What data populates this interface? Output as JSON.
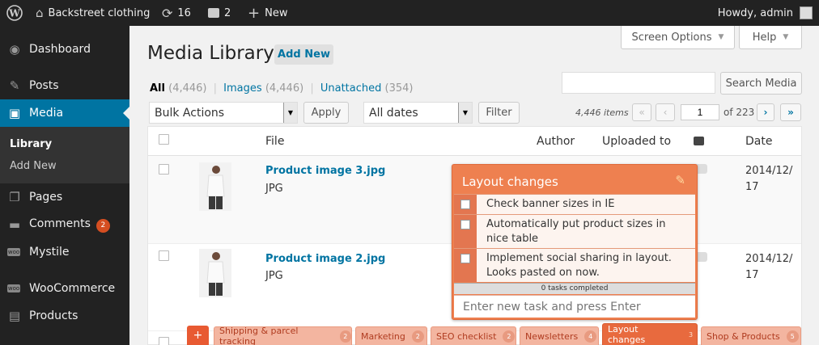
{
  "adminbar": {
    "site_name": "Backstreet clothing",
    "updates_count": "16",
    "comments_count": "2",
    "new_label": "New",
    "howdy": "Howdy, admin"
  },
  "sidebar": {
    "items": [
      {
        "label": "Dashboard",
        "icon": "dashboard-icon"
      },
      {
        "label": "Posts",
        "icon": "pin-icon"
      },
      {
        "label": "Media",
        "icon": "media-icon"
      },
      {
        "label": "Pages",
        "icon": "pages-icon"
      },
      {
        "label": "Comments",
        "icon": "comment-icon",
        "badge": "2"
      },
      {
        "label": "Mystile",
        "icon": "woo-icon"
      },
      {
        "label": "WooCommerce",
        "icon": "woo-icon"
      },
      {
        "label": "Products",
        "icon": "products-icon"
      }
    ],
    "submenu": [
      "Library",
      "Add New"
    ]
  },
  "header": {
    "title": "Media Library",
    "add_new": "Add New",
    "screen_options": "Screen Options",
    "help": "Help"
  },
  "filters": {
    "all": "All",
    "all_count": "(4,446)",
    "images": "Images",
    "images_count": "(4,446)",
    "unattached": "Unattached",
    "unattached_count": "(354)",
    "sep": "|"
  },
  "search": {
    "value": "",
    "button": "Search Media"
  },
  "toolbar": {
    "bulk_actions": "Bulk Actions",
    "apply": "Apply",
    "dates": "All dates",
    "filter": "Filter",
    "items": "4,446 items",
    "first": "«",
    "prev": "‹",
    "page": "1",
    "of_pages": "of 223",
    "next": "›",
    "last": "»"
  },
  "table": {
    "headers": {
      "file": "File",
      "author": "Author",
      "uploaded_to": "Uploaded to",
      "date": "Date"
    },
    "rows": [
      {
        "name": "Product image 3.jpg",
        "type": "JPG",
        "date_line1": "2014/12/",
        "date_line2": "17"
      },
      {
        "name": "Product image 2.jpg",
        "type": "JPG",
        "date_line1": "2014/12/",
        "date_line2": "17"
      }
    ]
  },
  "tasks_popup": {
    "title": "Layout changes",
    "tasks": [
      "Check banner sizes in IE",
      "Automatically put product sizes in nice table",
      "Implement social sharing in layout. Looks pasted on now."
    ],
    "completed": "0 tasks completed",
    "placeholder": "Enter new task and press Enter"
  },
  "tabs": {
    "add": "+",
    "items": [
      {
        "label": "Shipping & parcel tracking",
        "count": "2"
      },
      {
        "label": "Marketing",
        "count": "2"
      },
      {
        "label": "SEO checklist",
        "count": "2"
      },
      {
        "label": "Newsletters",
        "count": "4"
      },
      {
        "label": "Layout changes",
        "count": "3"
      },
      {
        "label": "Shop & Products",
        "count": "5"
      }
    ]
  },
  "colors": {
    "accent": "#0074a2",
    "popup": "#ee8050",
    "badge": "#d54e21"
  }
}
